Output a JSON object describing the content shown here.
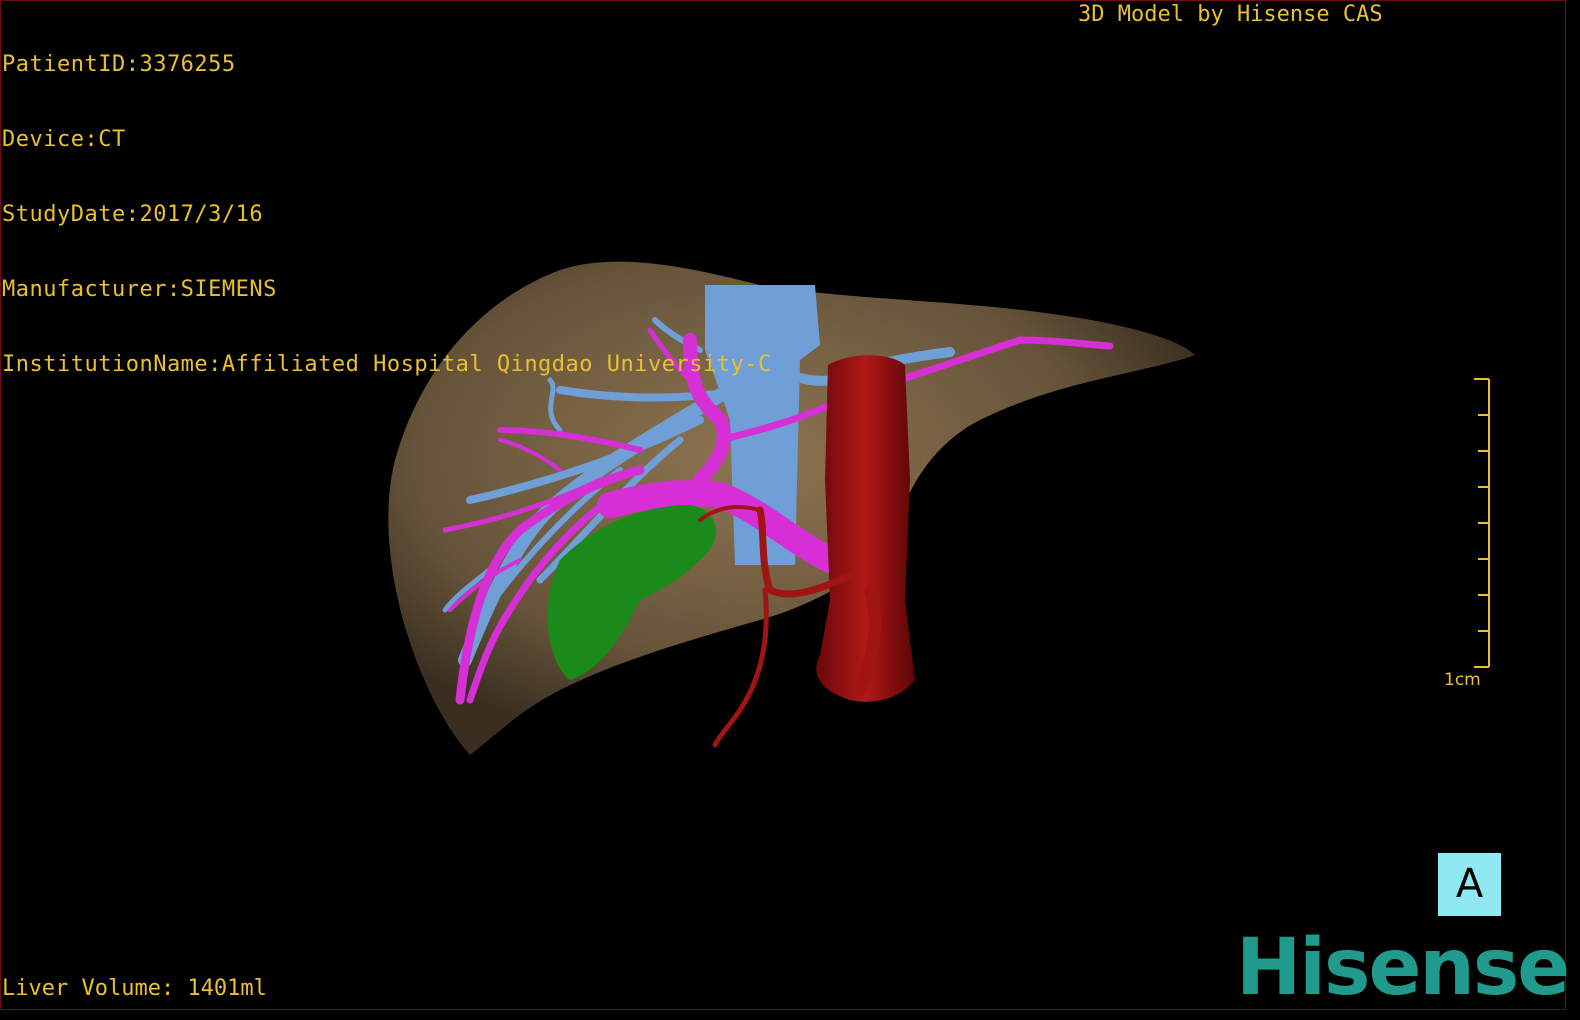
{
  "header": {
    "patient_id": "PatientID:3376255",
    "device": "Device:CT",
    "study_date": "StudyDate:2017/3/16",
    "manufacturer": "Manufacturer:SIEMENS",
    "institution": "InstitutionName:Affiliated Hospital Qingdao University-C"
  },
  "credit": "3D Model by Hisense CAS",
  "footer": {
    "liver_volume": "Liver Volume: 1401ml"
  },
  "scale_bar": {
    "label": "1cm"
  },
  "orientation_marker": {
    "label": "A"
  },
  "logo": {
    "text": "Hisense"
  },
  "colors": {
    "overlay_text": "#e8c030",
    "liver": "#7a6446",
    "hepatic_vein": "#6f9fd6",
    "portal_vein": "#d62fd6",
    "gallbladder": "#1a8a1a",
    "artery_ivc": "#9a1010",
    "orientation_bg": "#8fe8f2",
    "logo": "#1f9a8c"
  }
}
